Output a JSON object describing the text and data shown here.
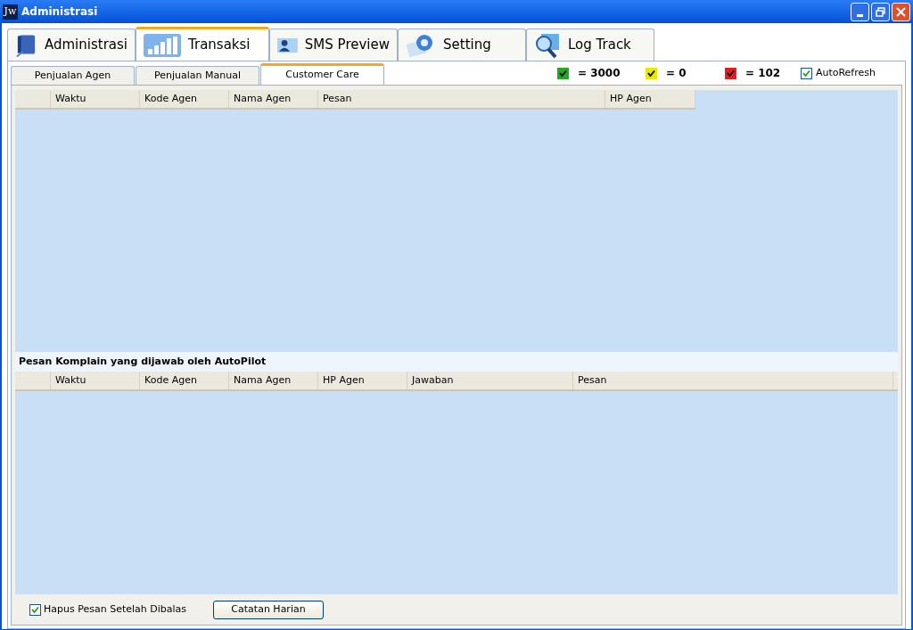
{
  "window": {
    "title": "Administrasi",
    "icon_text": "Jw"
  },
  "tabs": [
    {
      "label": "Administrasi",
      "selected": false
    },
    {
      "label": "Transaksi",
      "selected": true
    },
    {
      "label": "SMS Preview",
      "selected": false
    },
    {
      "label": "Setting",
      "selected": false
    },
    {
      "label": "Log Track",
      "selected": false
    }
  ],
  "sub_tabs": [
    {
      "label": "Penjualan Agen",
      "selected": false
    },
    {
      "label": "Penjualan Manual",
      "selected": false
    },
    {
      "label": "Customer Care",
      "selected": true
    }
  ],
  "legend": [
    {
      "color": "#22a822",
      "checked": true,
      "text": "= 3000"
    },
    {
      "color": "#e8e800",
      "checked": true,
      "text": "= 0"
    },
    {
      "color": "#e02020",
      "checked": true,
      "text": "= 102"
    }
  ],
  "auto_refresh": {
    "label": "AutoRefresh",
    "checked": true
  },
  "table": {
    "columns": [
      "",
      "Waktu",
      "Kode Agen",
      "Nama Agen",
      "Pesan",
      "HP Agen"
    ]
  },
  "autopilot_section": {
    "title": "Pesan Komplain yang dijawab oleh AutoPilot",
    "columns": [
      "",
      "Waktu",
      "Kode Agen",
      "Nama Agen",
      "HP Agen",
      "Jawaban",
      "Pesan"
    ]
  },
  "delete_after_reply": {
    "label": "Hapus Pesan Setelah Dibalas",
    "checked": true
  },
  "buttons": [
    "Catatan Harian"
  ]
}
